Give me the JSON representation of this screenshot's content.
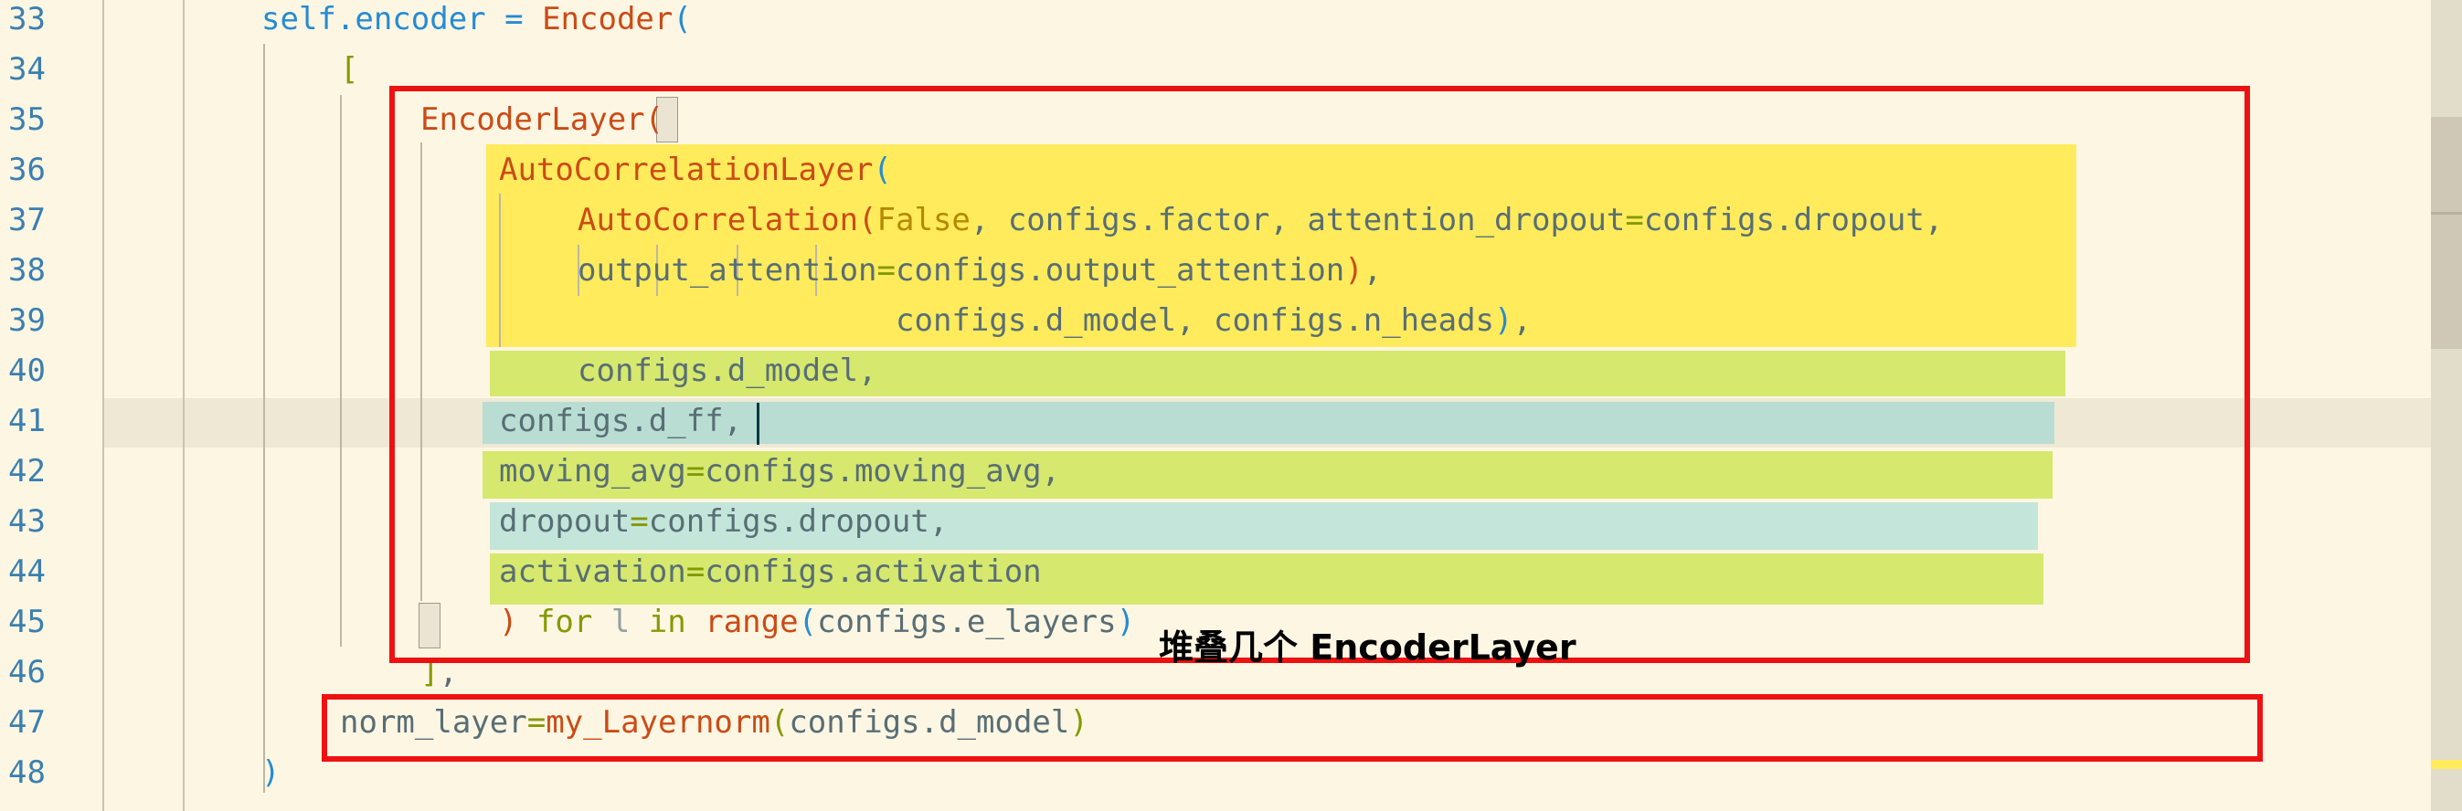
{
  "editor": {
    "lines": [
      {
        "num": "33",
        "tokens": [
          {
            "t": "self",
            "c": "t-self"
          },
          {
            "t": ".encoder = ",
            "c": "t-self"
          },
          {
            "t": "Encoder",
            "c": "t-cls"
          },
          {
            "t": "(",
            "c": "t-paren"
          }
        ]
      },
      {
        "num": "34",
        "tokens": [
          {
            "t": "[",
            "c": "t-green"
          }
        ]
      },
      {
        "num": "35",
        "tokens": [
          {
            "t": "EncoderLayer",
            "c": "t-cls"
          },
          {
            "t": "(",
            "c": "t-cls"
          }
        ]
      },
      {
        "num": "36",
        "tokens": [
          {
            "t": "AutoCorrelationLayer",
            "c": "t-cls"
          },
          {
            "t": "(",
            "c": "t-paren"
          }
        ]
      },
      {
        "num": "37",
        "tokens": [
          {
            "t": "AutoCorrelation",
            "c": "t-cls"
          },
          {
            "t": "(",
            "c": "t-cls"
          },
          {
            "t": "False",
            "c": "t-const"
          },
          {
            "t": ", configs.factor, attention_dropout",
            "c": "t-plain"
          },
          {
            "t": "=",
            "c": "t-op"
          },
          {
            "t": "configs.dropout,",
            "c": "t-plain"
          }
        ]
      },
      {
        "num": "38",
        "tokens": [
          {
            "t": "output_attention",
            "c": "t-plain"
          },
          {
            "t": "=",
            "c": "t-op"
          },
          {
            "t": "configs.output_attention",
            "c": "t-plain"
          },
          {
            "t": ")",
            "c": "t-cls"
          },
          {
            "t": ",",
            "c": "t-plain"
          }
        ]
      },
      {
        "num": "39",
        "tokens": [
          {
            "t": "configs.d_model, configs.n_heads",
            "c": "t-plain"
          },
          {
            "t": ")",
            "c": "t-paren"
          },
          {
            "t": ",",
            "c": "t-plain"
          }
        ]
      },
      {
        "num": "40",
        "tokens": [
          {
            "t": "configs.d_model,",
            "c": "t-plain"
          }
        ]
      },
      {
        "num": "41",
        "tokens": [
          {
            "t": "configs.d_ff,",
            "c": "t-plain"
          }
        ]
      },
      {
        "num": "42",
        "tokens": [
          {
            "t": "moving_avg",
            "c": "t-plain"
          },
          {
            "t": "=",
            "c": "t-op"
          },
          {
            "t": "configs.moving_avg,",
            "c": "t-plain"
          }
        ]
      },
      {
        "num": "43",
        "tokens": [
          {
            "t": "dropout",
            "c": "t-plain"
          },
          {
            "t": "=",
            "c": "t-op"
          },
          {
            "t": "configs.dropout,",
            "c": "t-plain"
          }
        ]
      },
      {
        "num": "44",
        "tokens": [
          {
            "t": "activation",
            "c": "t-plain"
          },
          {
            "t": "=",
            "c": "t-op"
          },
          {
            "t": "configs.activation",
            "c": "t-plain"
          }
        ]
      },
      {
        "num": "45",
        "tokens": [
          {
            "t": ")",
            "c": "t-cls"
          },
          {
            "t": " for ",
            "c": "t-kw"
          },
          {
            "t": "l",
            "c": "t-var"
          },
          {
            "t": " in ",
            "c": "t-kw"
          },
          {
            "t": "range",
            "c": "t-cls"
          },
          {
            "t": "(",
            "c": "t-paren"
          },
          {
            "t": "configs.e_layers",
            "c": "t-plain"
          },
          {
            "t": ")",
            "c": "t-paren"
          }
        ]
      },
      {
        "num": "46",
        "tokens": [
          {
            "t": "]",
            "c": "t-green"
          },
          {
            "t": ",",
            "c": "t-plain"
          }
        ]
      },
      {
        "num": "47",
        "tokens": [
          {
            "t": "norm_layer",
            "c": "t-plain"
          },
          {
            "t": "=",
            "c": "t-op"
          },
          {
            "t": "my_Layernorm",
            "c": "t-cls"
          },
          {
            "t": "(",
            "c": "t-green"
          },
          {
            "t": "configs.d_model",
            "c": "t-plain"
          },
          {
            "t": ")",
            "c": "t-green"
          }
        ]
      },
      {
        "num": "48",
        "tokens": [
          {
            "t": ")",
            "c": "t-paren"
          }
        ]
      }
    ]
  },
  "annotation": {
    "text": "堆叠几个 EncoderLayer"
  },
  "colors": {
    "background": "#fdf6e3",
    "highlight_yellow": "#ffeb5c",
    "highlight_green": "#d6e86e",
    "highlight_teal": "#b9ddd2",
    "highlight_teal_light": "#c4e6da",
    "box_red": "#ee1111",
    "current_line": "#eee8d5"
  }
}
